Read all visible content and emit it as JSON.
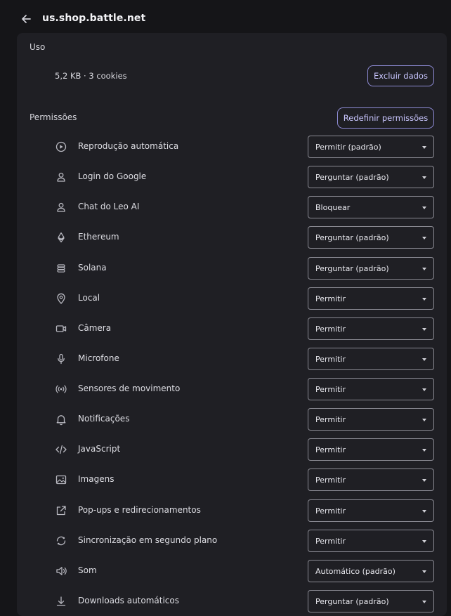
{
  "header": {
    "title": "us.shop.battle.net"
  },
  "usage": {
    "title": "Uso",
    "summary": "5,2 KB · 3 cookies",
    "clear_button": "Excluir dados"
  },
  "permissions": {
    "title": "Permissões",
    "reset_button": "Redefinir permissões",
    "items": [
      {
        "icon": "autoplay-icon",
        "label": "Reprodução automática",
        "value": "Permitir (padrão)"
      },
      {
        "icon": "person-icon",
        "label": "Login do Google",
        "value": "Perguntar (padrão)"
      },
      {
        "icon": "person-icon",
        "label": "Chat do Leo AI",
        "value": "Bloquear"
      },
      {
        "icon": "ethereum-icon",
        "label": "Ethereum",
        "value": "Perguntar (padrão)"
      },
      {
        "icon": "solana-icon",
        "label": "Solana",
        "value": "Perguntar (padrão)"
      },
      {
        "icon": "location-icon",
        "label": "Local",
        "value": "Permitir"
      },
      {
        "icon": "camera-icon",
        "label": "Câmera",
        "value": "Permitir"
      },
      {
        "icon": "microphone-icon",
        "label": "Microfone",
        "value": "Permitir"
      },
      {
        "icon": "motion-sensors-icon",
        "label": "Sensores de movimento",
        "value": "Permitir"
      },
      {
        "icon": "bell-icon",
        "label": "Notificações",
        "value": "Permitir"
      },
      {
        "icon": "code-icon",
        "label": "JavaScript",
        "value": "Permitir"
      },
      {
        "icon": "image-icon",
        "label": "Imagens",
        "value": "Permitir"
      },
      {
        "icon": "popup-icon",
        "label": "Pop-ups e redirecionamentos",
        "value": "Permitir"
      },
      {
        "icon": "sync-icon",
        "label": "Sincronização em segundo plano",
        "value": "Permitir"
      },
      {
        "icon": "speaker-icon",
        "label": "Som",
        "value": "Automático (padrão)"
      },
      {
        "icon": "download-icon",
        "label": "Downloads automáticos",
        "value": "Perguntar (padrão)"
      }
    ]
  },
  "colors": {
    "background": "#151518",
    "card": "#1f1f24",
    "accent": "#8f8cd6"
  }
}
